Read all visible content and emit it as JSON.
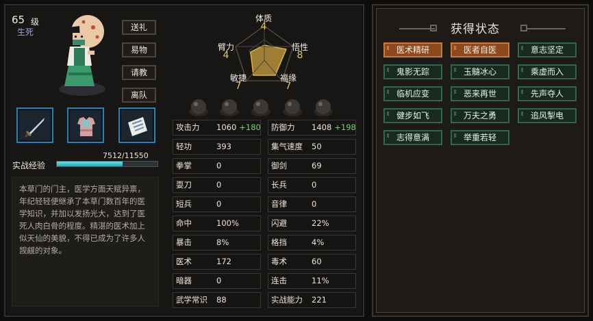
{
  "character": {
    "level": "65",
    "level_unit": "级",
    "title": "生死",
    "side_buttons": [
      "送礼",
      "易物",
      "请教",
      "离队"
    ],
    "items": [
      "sword",
      "armor",
      "scroll"
    ],
    "exp_label": "实战经验",
    "exp_text": "7512/11550",
    "exp_fraction": 0.65,
    "description": "本草门的门主，医学方面天赋异禀，年纪轻轻便继承了本草门数百年的医学知识，并加以发扬光大，达到了医死人肉白骨的程度。精湛的医术加上似天仙的美貌，不得已成为了许多人觊觎的对象。"
  },
  "radar": {
    "top": {
      "label": "体质",
      "value": "4"
    },
    "left": {
      "label": "臂力",
      "value": "4"
    },
    "right": {
      "label": "悟性",
      "value": "8"
    },
    "bottom_left": {
      "label": "敏捷",
      "value": "7"
    },
    "bottom_right": {
      "label": "福缘",
      "value": "7"
    }
  },
  "stats": [
    [
      {
        "k": "攻击力",
        "v": "1060",
        "b": "+180"
      },
      {
        "k": "防御力",
        "v": "1408",
        "b": "+198"
      }
    ],
    [
      {
        "k": "轻功",
        "v": "393"
      },
      {
        "k": "集气速度",
        "v": "50"
      }
    ],
    [
      {
        "k": "拳掌",
        "v": "0"
      },
      {
        "k": "御剑",
        "v": "69"
      }
    ],
    [
      {
        "k": "耍刀",
        "v": "0"
      },
      {
        "k": "长兵",
        "v": "0"
      }
    ],
    [
      {
        "k": "短兵",
        "v": "0"
      },
      {
        "k": "音律",
        "v": "0"
      }
    ],
    [
      {
        "k": "命中",
        "v": "100%"
      },
      {
        "k": "闪避",
        "v": "22%"
      }
    ],
    [
      {
        "k": "暴击",
        "v": "8%"
      },
      {
        "k": "格挡",
        "v": "4%"
      }
    ],
    [
      {
        "k": "医术",
        "v": "172"
      },
      {
        "k": "毒术",
        "v": "60"
      }
    ],
    [
      {
        "k": "暗器",
        "v": "0"
      },
      {
        "k": "连击",
        "v": "11%"
      }
    ],
    [
      {
        "k": "武学常识",
        "v": "88"
      },
      {
        "k": "实战能力",
        "v": "221"
      }
    ]
  ],
  "status_panel": {
    "title": "获得状态",
    "tags": [
      {
        "label": "医术精研",
        "type": "orange"
      },
      {
        "label": "医者自医",
        "type": "orange"
      },
      {
        "label": "意志坚定",
        "type": "green"
      },
      {
        "label": "鬼影无踪",
        "type": "green"
      },
      {
        "label": "玉髓冰心",
        "type": "green"
      },
      {
        "label": "乘虚而入",
        "type": "green"
      },
      {
        "label": "临机应变",
        "type": "green"
      },
      {
        "label": "恶来再世",
        "type": "green"
      },
      {
        "label": "先声夺人",
        "type": "green"
      },
      {
        "label": "健步如飞",
        "type": "green"
      },
      {
        "label": "万夫之勇",
        "type": "green"
      },
      {
        "label": "追风掣电",
        "type": "green"
      },
      {
        "label": "志得意满",
        "type": "green"
      },
      {
        "label": "举重若轻",
        "type": "green"
      }
    ]
  },
  "colors": {
    "accent_gold": "#e6c65c",
    "exp_bar": "#2aa7b3",
    "tag_orange": "#8d4a1f",
    "tag_green": "#182a20"
  }
}
